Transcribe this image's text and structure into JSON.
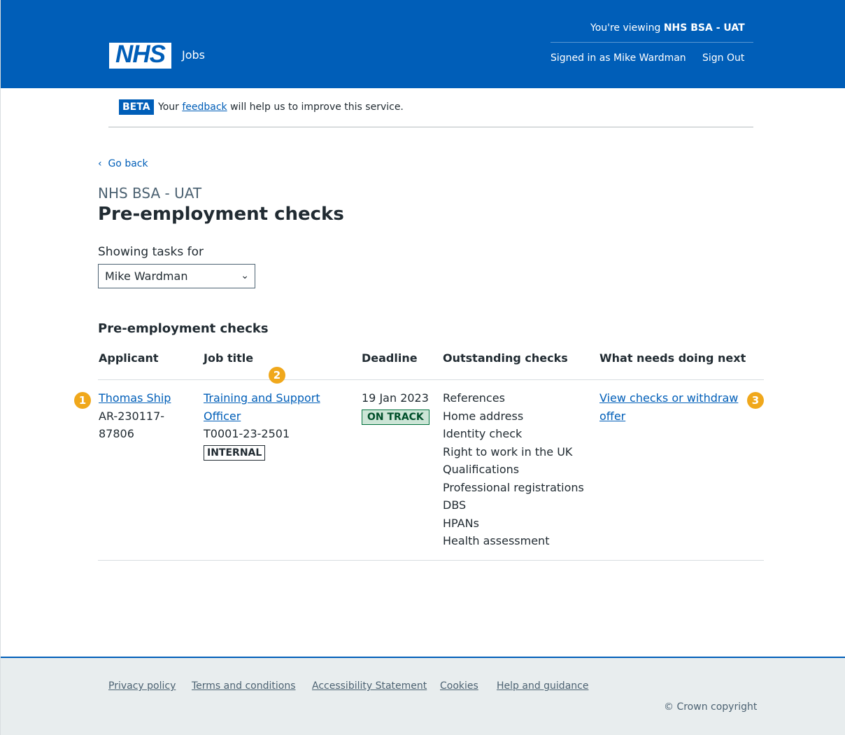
{
  "header": {
    "viewing_prefix": "You're viewing",
    "viewing_org": "NHS BSA - UAT",
    "logo": "NHS",
    "service_name": "Jobs",
    "signed_in": "Signed in as Mike Wardman",
    "sign_out": "Sign Out"
  },
  "beta": {
    "tag": "BETA",
    "text_before": "Your",
    "link": "feedback",
    "text_after": "will help us to improve this service."
  },
  "main": {
    "back": "Go back",
    "caption": "NHS BSA - UAT",
    "title": "Pre-employment checks",
    "filter_label": "Showing tasks for",
    "filter_value": "Mike Wardman",
    "table_title": "Pre-employment checks",
    "columns": [
      "Applicant",
      "Job title",
      "Deadline",
      "Outstanding checks",
      "What needs doing next"
    ],
    "rows": [
      {
        "applicant_name": "Thomas Ship",
        "applicant_ref_1": "AR-230117-",
        "applicant_ref_2": "87806",
        "job_title_1": "Training and Support",
        "job_title_2": "Officer",
        "job_ref": "T0001-23-2501",
        "job_tag": "INTERNAL",
        "deadline": "19 Jan 2023",
        "status": "ON TRACK",
        "checks": [
          "References",
          "Home address",
          "Identity check",
          "Right to work in the UK",
          "Qualifications",
          "Professional registrations",
          "DBS",
          "HPANs",
          "Health assessment"
        ],
        "action_1": "View checks or withdraw",
        "action_2": "offer"
      }
    ],
    "markers": [
      "1",
      "2",
      "3"
    ]
  },
  "footer": {
    "links": [
      "Privacy policy",
      "Terms and conditions",
      "Accessibility Statement",
      "Cookies",
      "Help and guidance"
    ],
    "copyright": "© Crown copyright"
  },
  "colors": {
    "nhs_blue": "#005eb8",
    "marker": "#f0a81c",
    "ontrack_bg": "#cce5d6"
  }
}
